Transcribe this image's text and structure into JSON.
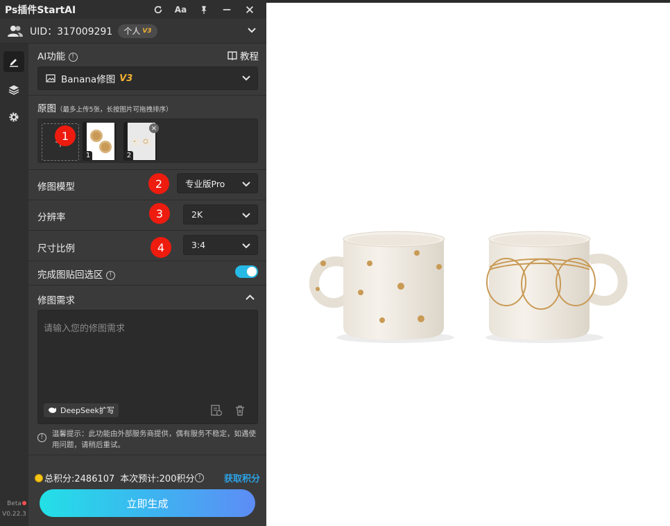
{
  "window": {
    "title": "Ps插件StartAI",
    "text_size_icon": "Aa"
  },
  "user": {
    "uid": "UID：317009291",
    "plan": "个人",
    "plan_badge": "V3"
  },
  "rail": {
    "beta": "Beta",
    "version": "V0.22.3",
    "items": [
      "edit-icon",
      "layers-icon",
      "gear-icon"
    ]
  },
  "ai_function": {
    "label": "AI功能",
    "tutorial": "教程",
    "selected": "Banana修图",
    "selected_badge": "V3"
  },
  "source_images": {
    "label": "原图",
    "hint": "（最多上传5张，长按图片可拖拽排序）",
    "thumbs": [
      {
        "index": "1"
      },
      {
        "index": "2"
      }
    ]
  },
  "markers": [
    "1",
    "2",
    "3",
    "4"
  ],
  "settings": {
    "model": {
      "label": "修图模型",
      "value": "专业版Pro"
    },
    "resolution": {
      "label": "分辨率",
      "value": "2K"
    },
    "aspect": {
      "label": "尺寸比例",
      "value": "3:4"
    },
    "paste_back": {
      "label": "完成图贴回选区",
      "enabled": true
    }
  },
  "requirement": {
    "label": "修图需求",
    "placeholder": "请输入您的修图需求",
    "deepseek": "DeepSeek扩写"
  },
  "tip": "温馨提示：此功能由外部服务商提供，偶有服务不稳定，如遇使用问题，请稍后重试。",
  "footer": {
    "total_points": "总积分:2486107",
    "estimate": "本次预计:200积分",
    "get_points": "获取积分",
    "generate": "立即生成"
  },
  "colors": {
    "accent": "#27b9e6",
    "marker": "#ee1b0f",
    "badge_gold": "#f2b232",
    "link": "#2ca3e6"
  }
}
